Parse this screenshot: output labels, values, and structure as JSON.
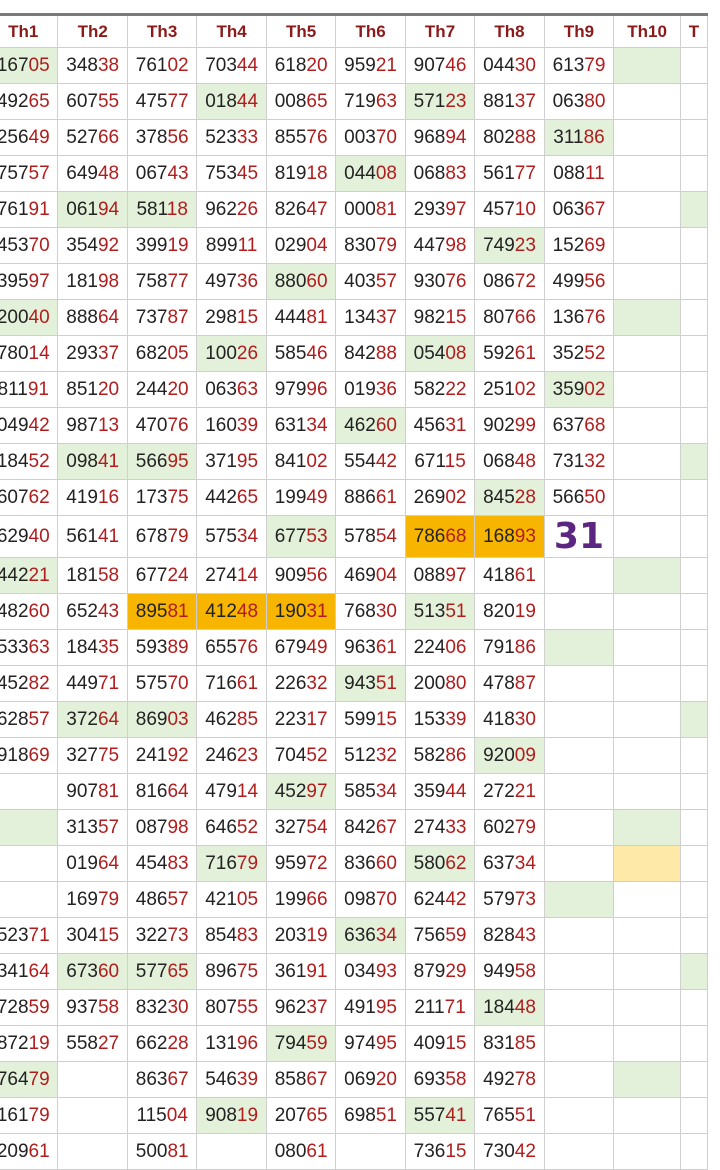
{
  "colors": {
    "green": "#e3f1da",
    "orange": "#f7b500",
    "yellow": "#ffe9a8",
    "header_text": "#8b1a1a",
    "tail_text": "#b11d1d",
    "special": "#5b2682"
  },
  "headers": [
    "Th1",
    "Th2",
    "Th3",
    "Th4",
    "Th5",
    "Th6",
    "Th7",
    "Th8",
    "Th9",
    "Th10",
    "T"
  ],
  "rows": [
    [
      {
        "v": "16705",
        "h": "g"
      },
      {
        "v": "34838"
      },
      {
        "v": "76102"
      },
      {
        "v": "70344"
      },
      {
        "v": "61820"
      },
      {
        "v": "95921"
      },
      {
        "v": "90746"
      },
      {
        "v": "04430"
      },
      {
        "v": "61379"
      },
      {
        "v": "",
        "h": "g"
      },
      {
        "v": ""
      }
    ],
    [
      {
        "v": "49265"
      },
      {
        "v": "60755"
      },
      {
        "v": "47577"
      },
      {
        "v": "01844",
        "h": "g"
      },
      {
        "v": "00865"
      },
      {
        "v": "71963"
      },
      {
        "v": "57123",
        "h": "g"
      },
      {
        "v": "88137"
      },
      {
        "v": "06380"
      },
      {
        "v": ""
      },
      {
        "v": ""
      }
    ],
    [
      {
        "v": "25649"
      },
      {
        "v": "52766"
      },
      {
        "v": "37856"
      },
      {
        "v": "52333"
      },
      {
        "v": "85576"
      },
      {
        "v": "00370"
      },
      {
        "v": "96894"
      },
      {
        "v": "80288"
      },
      {
        "v": "31186",
        "h": "g"
      },
      {
        "v": ""
      },
      {
        "v": ""
      }
    ],
    [
      {
        "v": "75757"
      },
      {
        "v": "64948"
      },
      {
        "v": "06743"
      },
      {
        "v": "75345"
      },
      {
        "v": "81918"
      },
      {
        "v": "04408",
        "h": "g"
      },
      {
        "v": "06883"
      },
      {
        "v": "56177"
      },
      {
        "v": "08811"
      },
      {
        "v": ""
      },
      {
        "v": ""
      }
    ],
    [
      {
        "v": "76191"
      },
      {
        "v": "06194",
        "h": "g"
      },
      {
        "v": "58118",
        "h": "g"
      },
      {
        "v": "96226"
      },
      {
        "v": "82647"
      },
      {
        "v": "00081"
      },
      {
        "v": "29397"
      },
      {
        "v": "45710"
      },
      {
        "v": "06367"
      },
      {
        "v": ""
      },
      {
        "v": "",
        "h": "g"
      }
    ],
    [
      {
        "v": "45370"
      },
      {
        "v": "35492"
      },
      {
        "v": "39919"
      },
      {
        "v": "89911"
      },
      {
        "v": "02904"
      },
      {
        "v": "83079"
      },
      {
        "v": "44798"
      },
      {
        "v": "74923",
        "h": "g"
      },
      {
        "v": "15269"
      },
      {
        "v": ""
      },
      {
        "v": ""
      }
    ],
    [
      {
        "v": "39597"
      },
      {
        "v": "18198"
      },
      {
        "v": "75877"
      },
      {
        "v": "49736"
      },
      {
        "v": "88060",
        "h": "g"
      },
      {
        "v": "40357"
      },
      {
        "v": "93076"
      },
      {
        "v": "08672"
      },
      {
        "v": "49956"
      },
      {
        "v": ""
      },
      {
        "v": ""
      }
    ],
    [
      {
        "v": "20040",
        "h": "g"
      },
      {
        "v": "88864"
      },
      {
        "v": "73787"
      },
      {
        "v": "29815"
      },
      {
        "v": "44481"
      },
      {
        "v": "13437"
      },
      {
        "v": "98215"
      },
      {
        "v": "80766"
      },
      {
        "v": "13676"
      },
      {
        "v": "",
        "h": "g"
      },
      {
        "v": ""
      }
    ],
    [
      {
        "v": "78014"
      },
      {
        "v": "29337"
      },
      {
        "v": "68205"
      },
      {
        "v": "10026",
        "h": "g"
      },
      {
        "v": "58546"
      },
      {
        "v": "84288"
      },
      {
        "v": "05408",
        "h": "g"
      },
      {
        "v": "59261"
      },
      {
        "v": "35252"
      },
      {
        "v": ""
      },
      {
        "v": ""
      }
    ],
    [
      {
        "v": "81191"
      },
      {
        "v": "85120"
      },
      {
        "v": "24420"
      },
      {
        "v": "06363"
      },
      {
        "v": "97996"
      },
      {
        "v": "01936"
      },
      {
        "v": "58222"
      },
      {
        "v": "25102"
      },
      {
        "v": "35902",
        "h": "g"
      },
      {
        "v": ""
      },
      {
        "v": ""
      }
    ],
    [
      {
        "v": "04942"
      },
      {
        "v": "98713"
      },
      {
        "v": "47076"
      },
      {
        "v": "16039"
      },
      {
        "v": "63134"
      },
      {
        "v": "46260",
        "h": "g"
      },
      {
        "v": "45631"
      },
      {
        "v": "90299"
      },
      {
        "v": "63768"
      },
      {
        "v": ""
      },
      {
        "v": ""
      }
    ],
    [
      {
        "v": "18452"
      },
      {
        "v": "09841",
        "h": "g"
      },
      {
        "v": "56695",
        "h": "g"
      },
      {
        "v": "37195"
      },
      {
        "v": "84102"
      },
      {
        "v": "55442"
      },
      {
        "v": "67115"
      },
      {
        "v": "06848"
      },
      {
        "v": "73132"
      },
      {
        "v": ""
      },
      {
        "v": "",
        "h": "g"
      }
    ],
    [
      {
        "v": "60762"
      },
      {
        "v": "41916"
      },
      {
        "v": "17375"
      },
      {
        "v": "44265"
      },
      {
        "v": "19949"
      },
      {
        "v": "88661"
      },
      {
        "v": "26902"
      },
      {
        "v": "84528",
        "h": "g"
      },
      {
        "v": "56650"
      },
      {
        "v": ""
      },
      {
        "v": ""
      }
    ],
    [
      {
        "v": "62940"
      },
      {
        "v": "56141"
      },
      {
        "v": "67879"
      },
      {
        "v": "57534"
      },
      {
        "v": "67753",
        "h": "g"
      },
      {
        "v": "57854"
      },
      {
        "v": "78668",
        "h": "o"
      },
      {
        "v": "16893",
        "h": "o"
      },
      {
        "v": "31",
        "s": true
      },
      {
        "v": ""
      },
      {
        "v": ""
      }
    ],
    [
      {
        "v": "44221",
        "h": "g"
      },
      {
        "v": "18158"
      },
      {
        "v": "67724"
      },
      {
        "v": "27414"
      },
      {
        "v": "90956"
      },
      {
        "v": "46904"
      },
      {
        "v": "08897"
      },
      {
        "v": "41861"
      },
      {
        "v": ""
      },
      {
        "v": "",
        "h": "g"
      },
      {
        "v": ""
      }
    ],
    [
      {
        "v": "48260"
      },
      {
        "v": "65243"
      },
      {
        "v": "89581",
        "h": "o"
      },
      {
        "v": "41248",
        "h": "o"
      },
      {
        "v": "19031",
        "h": "o"
      },
      {
        "v": "76830"
      },
      {
        "v": "51351",
        "h": "g"
      },
      {
        "v": "82019"
      },
      {
        "v": ""
      },
      {
        "v": ""
      },
      {
        "v": ""
      }
    ],
    [
      {
        "v": "53363"
      },
      {
        "v": "18435"
      },
      {
        "v": "59389"
      },
      {
        "v": "65576"
      },
      {
        "v": "67949"
      },
      {
        "v": "96361"
      },
      {
        "v": "22406"
      },
      {
        "v": "79186"
      },
      {
        "v": "",
        "h": "g"
      },
      {
        "v": ""
      },
      {
        "v": ""
      }
    ],
    [
      {
        "v": "45282"
      },
      {
        "v": "44971"
      },
      {
        "v": "57570"
      },
      {
        "v": "71661"
      },
      {
        "v": "22632"
      },
      {
        "v": "94351",
        "h": "g"
      },
      {
        "v": "20080"
      },
      {
        "v": "47887"
      },
      {
        "v": ""
      },
      {
        "v": ""
      },
      {
        "v": ""
      }
    ],
    [
      {
        "v": "62857"
      },
      {
        "v": "37264",
        "h": "g"
      },
      {
        "v": "86903",
        "h": "g"
      },
      {
        "v": "46285"
      },
      {
        "v": "22317"
      },
      {
        "v": "59915"
      },
      {
        "v": "15339"
      },
      {
        "v": "41830"
      },
      {
        "v": ""
      },
      {
        "v": ""
      },
      {
        "v": "",
        "h": "g"
      }
    ],
    [
      {
        "v": "91869"
      },
      {
        "v": "32775"
      },
      {
        "v": "24192"
      },
      {
        "v": "24623"
      },
      {
        "v": "70452"
      },
      {
        "v": "51232"
      },
      {
        "v": "58286"
      },
      {
        "v": "92009",
        "h": "g"
      },
      {
        "v": ""
      },
      {
        "v": ""
      },
      {
        "v": ""
      }
    ],
    [
      {
        "v": ""
      },
      {
        "v": "90781"
      },
      {
        "v": "81664"
      },
      {
        "v": "47914"
      },
      {
        "v": "45297",
        "h": "g"
      },
      {
        "v": "58534"
      },
      {
        "v": "35944"
      },
      {
        "v": "27221"
      },
      {
        "v": ""
      },
      {
        "v": ""
      },
      {
        "v": ""
      }
    ],
    [
      {
        "v": "",
        "h": "g"
      },
      {
        "v": "31357"
      },
      {
        "v": "08798"
      },
      {
        "v": "64652"
      },
      {
        "v": "32754"
      },
      {
        "v": "84267"
      },
      {
        "v": "27433"
      },
      {
        "v": "60279"
      },
      {
        "v": ""
      },
      {
        "v": "",
        "h": "g"
      },
      {
        "v": ""
      }
    ],
    [
      {
        "v": ""
      },
      {
        "v": "01964"
      },
      {
        "v": "45483"
      },
      {
        "v": "71679",
        "h": "g"
      },
      {
        "v": "95972"
      },
      {
        "v": "83660"
      },
      {
        "v": "58062",
        "h": "g"
      },
      {
        "v": "63734"
      },
      {
        "v": ""
      },
      {
        "v": "",
        "h": "y"
      },
      {
        "v": ""
      }
    ],
    [
      {
        "v": ""
      },
      {
        "v": "16979"
      },
      {
        "v": "48657"
      },
      {
        "v": "42105"
      },
      {
        "v": "19966"
      },
      {
        "v": "09870"
      },
      {
        "v": "62442"
      },
      {
        "v": "57973"
      },
      {
        "v": "",
        "h": "g"
      },
      {
        "v": ""
      },
      {
        "v": ""
      }
    ],
    [
      {
        "v": "52371"
      },
      {
        "v": "30415"
      },
      {
        "v": "32273"
      },
      {
        "v": "85483"
      },
      {
        "v": "20319"
      },
      {
        "v": "63634",
        "h": "g"
      },
      {
        "v": "75659"
      },
      {
        "v": "82843"
      },
      {
        "v": ""
      },
      {
        "v": ""
      },
      {
        "v": ""
      }
    ],
    [
      {
        "v": "34164"
      },
      {
        "v": "67360",
        "h": "g"
      },
      {
        "v": "57765",
        "h": "g"
      },
      {
        "v": "89675"
      },
      {
        "v": "36191"
      },
      {
        "v": "03493"
      },
      {
        "v": "87929"
      },
      {
        "v": "94958"
      },
      {
        "v": ""
      },
      {
        "v": ""
      },
      {
        "v": "",
        "h": "g"
      }
    ],
    [
      {
        "v": "72859"
      },
      {
        "v": "93758"
      },
      {
        "v": "83230"
      },
      {
        "v": "80755"
      },
      {
        "v": "96237"
      },
      {
        "v": "49195"
      },
      {
        "v": "21171"
      },
      {
        "v": "18448",
        "h": "g"
      },
      {
        "v": ""
      },
      {
        "v": ""
      },
      {
        "v": ""
      }
    ],
    [
      {
        "v": "87219"
      },
      {
        "v": "55827"
      },
      {
        "v": "66228"
      },
      {
        "v": "13196"
      },
      {
        "v": "79459",
        "h": "g"
      },
      {
        "v": "97495"
      },
      {
        "v": "40915"
      },
      {
        "v": "83185"
      },
      {
        "v": ""
      },
      {
        "v": ""
      },
      {
        "v": ""
      }
    ],
    [
      {
        "v": "76479",
        "h": "g"
      },
      {
        "v": ""
      },
      {
        "v": "86367"
      },
      {
        "v": "54639"
      },
      {
        "v": "85867"
      },
      {
        "v": "06920"
      },
      {
        "v": "69358"
      },
      {
        "v": "49278"
      },
      {
        "v": ""
      },
      {
        "v": "",
        "h": "g"
      },
      {
        "v": ""
      }
    ],
    [
      {
        "v": "16179"
      },
      {
        "v": ""
      },
      {
        "v": "11504"
      },
      {
        "v": "90819",
        "h": "g"
      },
      {
        "v": "20765"
      },
      {
        "v": "69851"
      },
      {
        "v": "55741",
        "h": "g"
      },
      {
        "v": "76551"
      },
      {
        "v": ""
      },
      {
        "v": ""
      },
      {
        "v": ""
      }
    ],
    [
      {
        "v": "20961"
      },
      {
        "v": ""
      },
      {
        "v": "50081"
      },
      {
        "v": ""
      },
      {
        "v": "08061"
      },
      {
        "v": ""
      },
      {
        "v": "73615"
      },
      {
        "v": "73042"
      },
      {
        "v": ""
      },
      {
        "v": ""
      },
      {
        "v": ""
      }
    ]
  ]
}
